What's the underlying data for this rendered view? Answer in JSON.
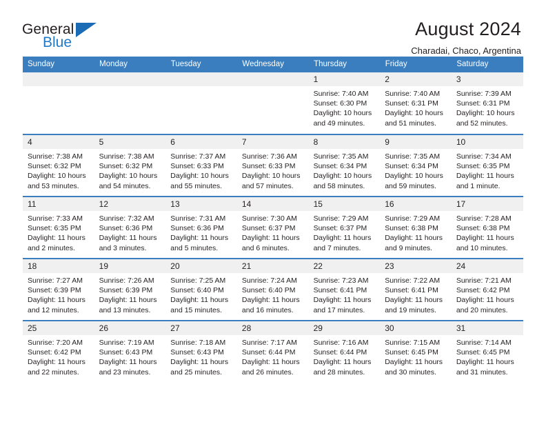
{
  "brand": {
    "line1": "General",
    "line2": "Blue",
    "triangle_color": "#1b6cb5"
  },
  "header": {
    "title": "August 2024",
    "subtitle": "Charadai, Chaco, Argentina"
  },
  "theme": {
    "header_bg": "#3a7ebf",
    "daynum_bg": "#f0f0f0",
    "text": "#231f20"
  },
  "weekdays": [
    "Sunday",
    "Monday",
    "Tuesday",
    "Wednesday",
    "Thursday",
    "Friday",
    "Saturday"
  ],
  "labels": {
    "sunrise_prefix": "Sunrise: ",
    "sunset_prefix": "Sunset: ",
    "daylight_prefix": "Daylight: "
  },
  "weeks": [
    [
      {
        "day": "",
        "empty": true
      },
      {
        "day": "",
        "empty": true
      },
      {
        "day": "",
        "empty": true
      },
      {
        "day": "",
        "empty": true
      },
      {
        "day": "1",
        "sunrise": "Sunrise: 7:40 AM",
        "sunset": "Sunset: 6:30 PM",
        "daylight_1": "Daylight: 10 hours",
        "daylight_2": "and 49 minutes."
      },
      {
        "day": "2",
        "sunrise": "Sunrise: 7:40 AM",
        "sunset": "Sunset: 6:31 PM",
        "daylight_1": "Daylight: 10 hours",
        "daylight_2": "and 51 minutes."
      },
      {
        "day": "3",
        "sunrise": "Sunrise: 7:39 AM",
        "sunset": "Sunset: 6:31 PM",
        "daylight_1": "Daylight: 10 hours",
        "daylight_2": "and 52 minutes."
      }
    ],
    [
      {
        "day": "4",
        "sunrise": "Sunrise: 7:38 AM",
        "sunset": "Sunset: 6:32 PM",
        "daylight_1": "Daylight: 10 hours",
        "daylight_2": "and 53 minutes."
      },
      {
        "day": "5",
        "sunrise": "Sunrise: 7:38 AM",
        "sunset": "Sunset: 6:32 PM",
        "daylight_1": "Daylight: 10 hours",
        "daylight_2": "and 54 minutes."
      },
      {
        "day": "6",
        "sunrise": "Sunrise: 7:37 AM",
        "sunset": "Sunset: 6:33 PM",
        "daylight_1": "Daylight: 10 hours",
        "daylight_2": "and 55 minutes."
      },
      {
        "day": "7",
        "sunrise": "Sunrise: 7:36 AM",
        "sunset": "Sunset: 6:33 PM",
        "daylight_1": "Daylight: 10 hours",
        "daylight_2": "and 57 minutes."
      },
      {
        "day": "8",
        "sunrise": "Sunrise: 7:35 AM",
        "sunset": "Sunset: 6:34 PM",
        "daylight_1": "Daylight: 10 hours",
        "daylight_2": "and 58 minutes."
      },
      {
        "day": "9",
        "sunrise": "Sunrise: 7:35 AM",
        "sunset": "Sunset: 6:34 PM",
        "daylight_1": "Daylight: 10 hours",
        "daylight_2": "and 59 minutes."
      },
      {
        "day": "10",
        "sunrise": "Sunrise: 7:34 AM",
        "sunset": "Sunset: 6:35 PM",
        "daylight_1": "Daylight: 11 hours",
        "daylight_2": "and 1 minute."
      }
    ],
    [
      {
        "day": "11",
        "sunrise": "Sunrise: 7:33 AM",
        "sunset": "Sunset: 6:35 PM",
        "daylight_1": "Daylight: 11 hours",
        "daylight_2": "and 2 minutes."
      },
      {
        "day": "12",
        "sunrise": "Sunrise: 7:32 AM",
        "sunset": "Sunset: 6:36 PM",
        "daylight_1": "Daylight: 11 hours",
        "daylight_2": "and 3 minutes."
      },
      {
        "day": "13",
        "sunrise": "Sunrise: 7:31 AM",
        "sunset": "Sunset: 6:36 PM",
        "daylight_1": "Daylight: 11 hours",
        "daylight_2": "and 5 minutes."
      },
      {
        "day": "14",
        "sunrise": "Sunrise: 7:30 AM",
        "sunset": "Sunset: 6:37 PM",
        "daylight_1": "Daylight: 11 hours",
        "daylight_2": "and 6 minutes."
      },
      {
        "day": "15",
        "sunrise": "Sunrise: 7:29 AM",
        "sunset": "Sunset: 6:37 PM",
        "daylight_1": "Daylight: 11 hours",
        "daylight_2": "and 7 minutes."
      },
      {
        "day": "16",
        "sunrise": "Sunrise: 7:29 AM",
        "sunset": "Sunset: 6:38 PM",
        "daylight_1": "Daylight: 11 hours",
        "daylight_2": "and 9 minutes."
      },
      {
        "day": "17",
        "sunrise": "Sunrise: 7:28 AM",
        "sunset": "Sunset: 6:38 PM",
        "daylight_1": "Daylight: 11 hours",
        "daylight_2": "and 10 minutes."
      }
    ],
    [
      {
        "day": "18",
        "sunrise": "Sunrise: 7:27 AM",
        "sunset": "Sunset: 6:39 PM",
        "daylight_1": "Daylight: 11 hours",
        "daylight_2": "and 12 minutes."
      },
      {
        "day": "19",
        "sunrise": "Sunrise: 7:26 AM",
        "sunset": "Sunset: 6:39 PM",
        "daylight_1": "Daylight: 11 hours",
        "daylight_2": "and 13 minutes."
      },
      {
        "day": "20",
        "sunrise": "Sunrise: 7:25 AM",
        "sunset": "Sunset: 6:40 PM",
        "daylight_1": "Daylight: 11 hours",
        "daylight_2": "and 15 minutes."
      },
      {
        "day": "21",
        "sunrise": "Sunrise: 7:24 AM",
        "sunset": "Sunset: 6:40 PM",
        "daylight_1": "Daylight: 11 hours",
        "daylight_2": "and 16 minutes."
      },
      {
        "day": "22",
        "sunrise": "Sunrise: 7:23 AM",
        "sunset": "Sunset: 6:41 PM",
        "daylight_1": "Daylight: 11 hours",
        "daylight_2": "and 17 minutes."
      },
      {
        "day": "23",
        "sunrise": "Sunrise: 7:22 AM",
        "sunset": "Sunset: 6:41 PM",
        "daylight_1": "Daylight: 11 hours",
        "daylight_2": "and 19 minutes."
      },
      {
        "day": "24",
        "sunrise": "Sunrise: 7:21 AM",
        "sunset": "Sunset: 6:42 PM",
        "daylight_1": "Daylight: 11 hours",
        "daylight_2": "and 20 minutes."
      }
    ],
    [
      {
        "day": "25",
        "sunrise": "Sunrise: 7:20 AM",
        "sunset": "Sunset: 6:42 PM",
        "daylight_1": "Daylight: 11 hours",
        "daylight_2": "and 22 minutes."
      },
      {
        "day": "26",
        "sunrise": "Sunrise: 7:19 AM",
        "sunset": "Sunset: 6:43 PM",
        "daylight_1": "Daylight: 11 hours",
        "daylight_2": "and 23 minutes."
      },
      {
        "day": "27",
        "sunrise": "Sunrise: 7:18 AM",
        "sunset": "Sunset: 6:43 PM",
        "daylight_1": "Daylight: 11 hours",
        "daylight_2": "and 25 minutes."
      },
      {
        "day": "28",
        "sunrise": "Sunrise: 7:17 AM",
        "sunset": "Sunset: 6:44 PM",
        "daylight_1": "Daylight: 11 hours",
        "daylight_2": "and 26 minutes."
      },
      {
        "day": "29",
        "sunrise": "Sunrise: 7:16 AM",
        "sunset": "Sunset: 6:44 PM",
        "daylight_1": "Daylight: 11 hours",
        "daylight_2": "and 28 minutes."
      },
      {
        "day": "30",
        "sunrise": "Sunrise: 7:15 AM",
        "sunset": "Sunset: 6:45 PM",
        "daylight_1": "Daylight: 11 hours",
        "daylight_2": "and 30 minutes."
      },
      {
        "day": "31",
        "sunrise": "Sunrise: 7:14 AM",
        "sunset": "Sunset: 6:45 PM",
        "daylight_1": "Daylight: 11 hours",
        "daylight_2": "and 31 minutes."
      }
    ]
  ]
}
